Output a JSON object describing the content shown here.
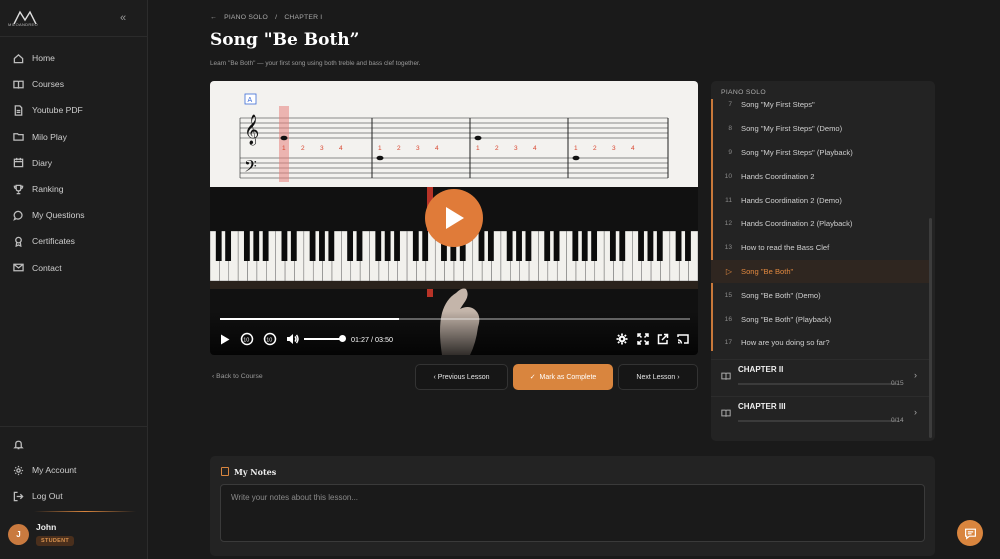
{
  "brand": {
    "logo_text": "MILOANDREO",
    "collapse_icon": "double-chevron-left-icon"
  },
  "nav": {
    "items": [
      {
        "label": "Home",
        "icon": "home-icon"
      },
      {
        "label": "Courses",
        "icon": "book-icon"
      },
      {
        "label": "Youtube PDF",
        "icon": "pdf-icon"
      },
      {
        "label": "Milo Play",
        "icon": "folder-icon"
      },
      {
        "label": "Diary",
        "icon": "calendar-icon"
      },
      {
        "label": "Ranking",
        "icon": "trophy-icon"
      },
      {
        "label": "My Questions",
        "icon": "chat-icon"
      },
      {
        "label": "Certificates",
        "icon": "award-icon"
      },
      {
        "label": "Contact",
        "icon": "mail-icon"
      }
    ],
    "bottom": [
      {
        "label": "",
        "icon": "bell-icon"
      },
      {
        "label": "My Account",
        "icon": "gear-icon"
      },
      {
        "label": "Log Out",
        "icon": "logout-icon"
      }
    ]
  },
  "user": {
    "initial": "J",
    "name": "John",
    "role": "STUDENT"
  },
  "breadcrumb": {
    "course": "PIANO SOLO",
    "separator": "/",
    "chapter": "CHAPTER I"
  },
  "page": {
    "title": "Song \"Be Both”",
    "subtitle": "Learn \"Be Both\" — your first song using both treble and bass clef together."
  },
  "video": {
    "current_time": "01:27",
    "time_separator": "/",
    "duration": "03:50",
    "progress": 0.38,
    "volume": 0.9,
    "rewind_label": "10",
    "forward_label": "10",
    "sheet_marker": "A",
    "fingering": [
      "1",
      "2",
      "3",
      "4"
    ]
  },
  "lesson_nav": {
    "back": "Back to Course",
    "previous": "Previous Lesson",
    "complete": "Mark as Complete",
    "next": "Next Lesson"
  },
  "playlist": {
    "header": "PIANO SOLO",
    "items": [
      {
        "num": "7",
        "title": "Song \"My First Steps\"",
        "active": false
      },
      {
        "num": "8",
        "title": "Song \"My First Steps\" (Demo)",
        "active": false
      },
      {
        "num": "9",
        "title": "Song \"My First Steps\" (Playback)",
        "active": false
      },
      {
        "num": "10",
        "title": "Hands Coordination 2",
        "active": false
      },
      {
        "num": "11",
        "title": "Hands Coordination 2 (Demo)",
        "active": false
      },
      {
        "num": "12",
        "title": "Hands Coordination 2 (Playback)",
        "active": false
      },
      {
        "num": "13",
        "title": "How to read the Bass Clef",
        "active": false
      },
      {
        "num": "",
        "title": "Song \"Be Both\"",
        "active": true
      },
      {
        "num": "15",
        "title": "Song \"Be Both\" (Demo)",
        "active": false
      },
      {
        "num": "16",
        "title": "Song \"Be Both\" (Playback)",
        "active": false
      },
      {
        "num": "17",
        "title": "How are you doing so far?",
        "active": false
      }
    ],
    "chapters": [
      {
        "name": "CHAPTER II",
        "count": "0/15",
        "progress": 0
      },
      {
        "name": "CHAPTER III",
        "count": "0/14",
        "progress": 0
      }
    ]
  },
  "notes": {
    "title": "My Notes",
    "placeholder": "Write your notes about this lesson..."
  },
  "colors": {
    "accent": "#d9853e",
    "background": "#1a1a1a",
    "panel": "#232323"
  }
}
